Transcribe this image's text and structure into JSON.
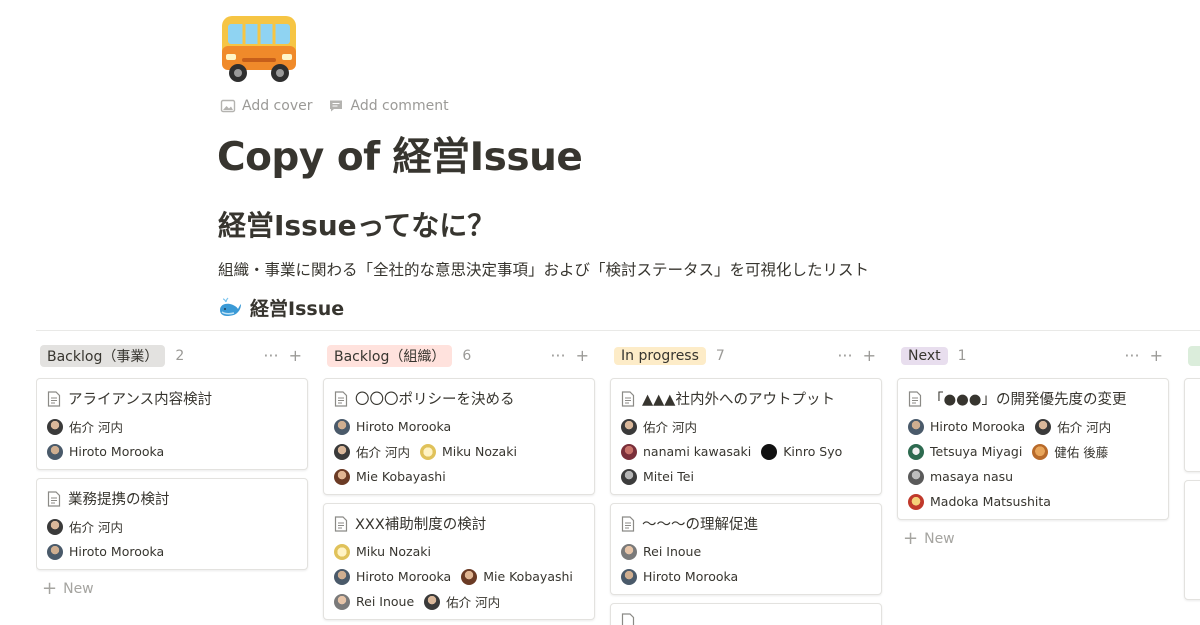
{
  "page": {
    "icon": "bus-icon",
    "actions": [
      {
        "label": "Add cover",
        "icon": "image-icon"
      },
      {
        "label": "Add comment",
        "icon": "comment-icon"
      }
    ],
    "title": "Copy of 経営Issue",
    "heading": "経営Issueってなに？",
    "description": "組織・事業に関わる「全社的な意思決定事項」および「検討ステータス」を可視化したリスト",
    "database_title": "経営Issue",
    "database_icon": "whale-icon"
  },
  "board": {
    "columns": [
      {
        "label": "Backlog（事業）",
        "count": "2",
        "color": "#e3e2e0",
        "cards": [
          {
            "title": "アライアンス内容検討",
            "people": [
              "佑介 河内",
              "Hiroto Morooka"
            ]
          },
          {
            "title": "業務提携の検討",
            "people": [
              "佑介 河内",
              "Hiroto Morooka"
            ]
          }
        ],
        "new_label": "New"
      },
      {
        "label": "Backlog（組織）",
        "count": "6",
        "color": "#ffe2dd",
        "cards": [
          {
            "title": "〇〇〇ポリシーを決める",
            "people": [
              "Hiroto Morooka",
              "佑介 河内",
              "Miku Nozaki",
              "Mie Kobayashi"
            ]
          },
          {
            "title": "XXX補助制度の検討",
            "people": [
              "Miku Nozaki",
              "Hiroto Morooka",
              "Mie Kobayashi",
              "Rei Inoue",
              "佑介 河内"
            ]
          }
        ]
      },
      {
        "label": "In progress",
        "count": "7",
        "color": "#fdecc8",
        "cards": [
          {
            "title": "▲▲▲社内外へのアウトプット",
            "people": [
              "佑介 河内",
              "nanami kawasaki",
              "Kinro Syo",
              "Mitei Tei"
            ]
          },
          {
            "title": "〜〜〜の理解促進",
            "people": [
              "Rei Inoue",
              "Hiroto Morooka"
            ]
          },
          {
            "title": "",
            "people": []
          }
        ]
      },
      {
        "label": "Next",
        "count": "1",
        "color": "#e8deee",
        "cards": [
          {
            "title": "「●●●」の開発優先度の変更",
            "people": [
              "Hiroto Morooka",
              "佑介 河内",
              "Tetsuya Miyagi",
              "健佑 後藤",
              "masaya nasu",
              "Madoka Matsushita"
            ]
          }
        ],
        "new_label": "New"
      }
    ],
    "more_label": "···",
    "add_label": "+"
  }
}
